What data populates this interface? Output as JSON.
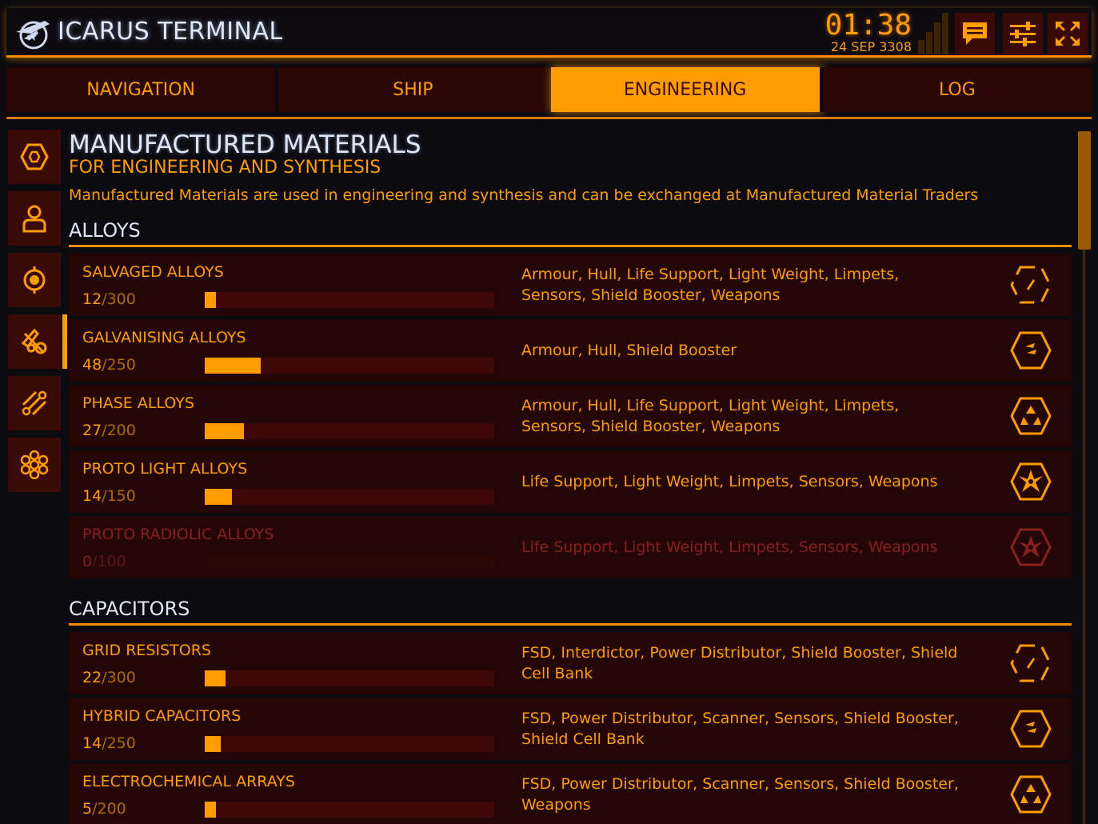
{
  "header": {
    "title": "ICARUS TERMINAL",
    "time": "01:38",
    "date": "24 SEP 3308",
    "icons": [
      "logo-icon",
      "signal-icon",
      "messages-icon",
      "settings-icon",
      "fullscreen-icon"
    ]
  },
  "tabs": [
    {
      "label": "NAVIGATION",
      "active": false
    },
    {
      "label": "SHIP",
      "active": false
    },
    {
      "label": "ENGINEERING",
      "active": true
    },
    {
      "label": "LOG",
      "active": false
    }
  ],
  "sidebar": {
    "items": [
      {
        "icon": "hexagon-icon"
      },
      {
        "icon": "person-icon"
      },
      {
        "icon": "target-icon"
      },
      {
        "icon": "tools-icon",
        "active": true
      },
      {
        "icon": "slash-circles-icon"
      },
      {
        "icon": "cluster-icon"
      }
    ]
  },
  "main": {
    "title": "MANUFACTURED MATERIALS",
    "subtitle": "FOR ENGINEERING AND SYNTHESIS",
    "description": "Manufactured Materials are used in engineering and synthesis and can be exchanged at Manufactured Material Traders",
    "sections": [
      {
        "title": "ALLOYS",
        "rows": [
          {
            "name": "SALVAGED ALLOYS",
            "count": "12",
            "max": "/300",
            "fraction": 0.04,
            "uses_1": "Armour, Hull, Life Support, Light Weight, Limpets,",
            "uses_2": "Sensors, Shield Booster, Weapons",
            "grade_icon": "grade-1-icon"
          },
          {
            "name": "GALVANISING ALLOYS",
            "count": "48",
            "max": "/250",
            "fraction": 0.192,
            "uses_1": "Armour, Hull, Shield Booster",
            "uses_2": "",
            "grade_icon": "grade-2-icon"
          },
          {
            "name": "PHASE ALLOYS",
            "count": "27",
            "max": "/200",
            "fraction": 0.135,
            "uses_1": "Armour, Hull, Life Support, Light Weight, Limpets,",
            "uses_2": "Sensors, Shield Booster, Weapons",
            "grade_icon": "grade-3-icon"
          },
          {
            "name": "PROTO LIGHT ALLOYS",
            "count": "14",
            "max": "/150",
            "fraction": 0.093,
            "uses_1": "Life Support, Light Weight, Limpets, Sensors, Weapons",
            "uses_2": "",
            "grade_icon": "grade-4-icon"
          },
          {
            "name": "PROTO RADIOLIC ALLOYS",
            "count": "0",
            "max": "/100",
            "fraction": 0,
            "uses_1": "Life Support, Light Weight, Limpets, Sensors, Weapons",
            "uses_2": "",
            "grade_icon": "grade-5-icon",
            "empty": true
          }
        ]
      },
      {
        "title": "CAPACITORS",
        "rows": [
          {
            "name": "GRID RESISTORS",
            "count": "22",
            "max": "/300",
            "fraction": 0.073,
            "uses_1": "FSD, Interdictor, Power Distributor, Shield Booster, Shield",
            "uses_2": "Cell Bank",
            "grade_icon": "grade-1-icon"
          },
          {
            "name": "HYBRID CAPACITORS",
            "count": "14",
            "max": "/250",
            "fraction": 0.056,
            "uses_1": "FSD, Power Distributor, Scanner, Sensors, Shield Booster,",
            "uses_2": "Shield Cell Bank",
            "grade_icon": "grade-2-icon"
          },
          {
            "name": "ELECTROCHEMICAL ARRAYS",
            "count": "5",
            "max": "/200",
            "fraction": 0.025,
            "uses_1": "FSD, Power Distributor, Scanner, Sensors, Shield Booster,",
            "uses_2": "Weapons",
            "grade_icon": "grade-3-icon"
          }
        ]
      }
    ]
  },
  "colors": {
    "accent": "#ff9c00",
    "panel": "#230605",
    "muted": "#8a1f1b",
    "title": "#dfe6f5"
  }
}
